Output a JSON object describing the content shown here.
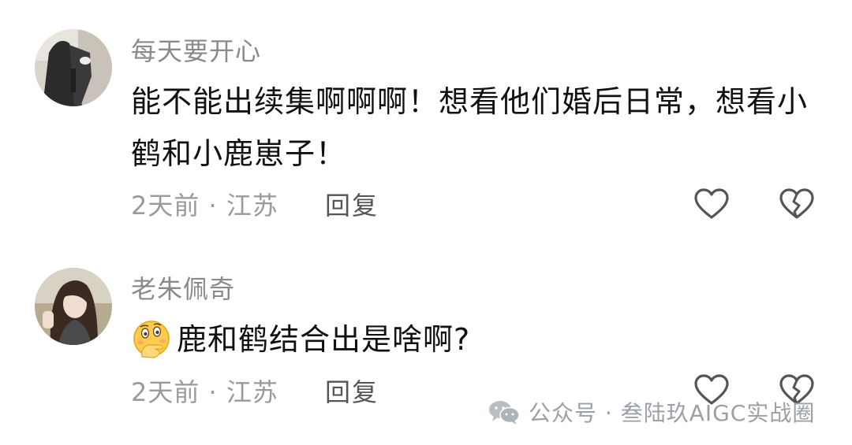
{
  "comments": [
    {
      "username": "每天要开心",
      "text": "能不能出续集啊啊啊！想看他们婚后日常，想看小鹤和小鹿崽子！",
      "meta": "2天前 · 江苏",
      "reply_label": "回复",
      "avatar_icon": "avatar-photo-person-dark-coat"
    },
    {
      "username": "老朱佩奇",
      "emoji_icon": "thinking-hand-over-mouth-emoji",
      "text": "鹿和鹤结合出是啥啊?",
      "meta": "2天前 · 江苏",
      "reply_label": "回复",
      "avatar_icon": "avatar-photo-woman-long-hair"
    }
  ],
  "watermark": {
    "icon": "wechat-icon",
    "text": "公众号 · 叁陆玖AIGC实战圈"
  },
  "colors": {
    "username": "#8a8a8a",
    "text": "#111111",
    "meta": "#9a9a9a",
    "reply": "#555555",
    "icon_stroke": "#555555"
  }
}
